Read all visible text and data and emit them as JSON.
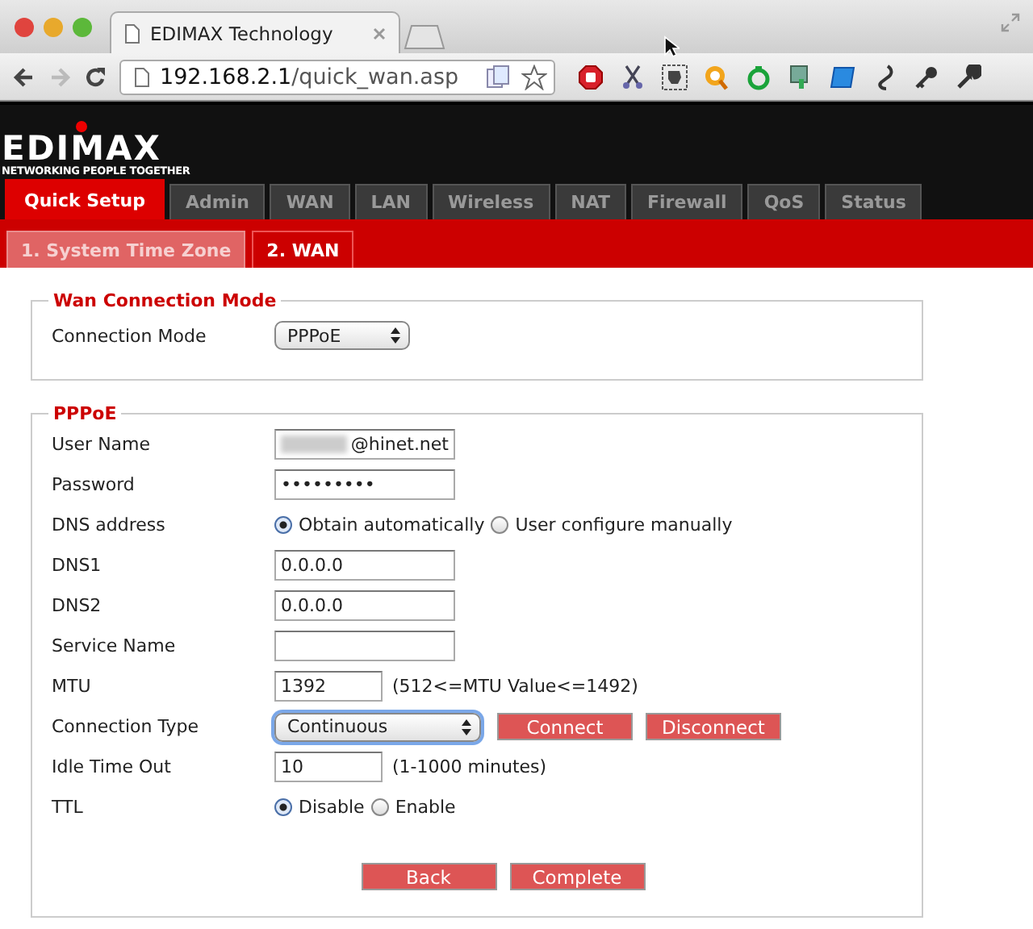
{
  "browser": {
    "tab_title": "EDIMAX Technology",
    "url_host": "192.168.2.1",
    "url_path": "/quick_wan.asp",
    "forward_disabled": true
  },
  "header": {
    "logo": "EDIMAX",
    "tagline": "NETWORKING PEOPLE TOGETHER"
  },
  "tabs": [
    {
      "label": "Quick Setup",
      "selected": true
    },
    {
      "label": "Admin",
      "selected": false
    },
    {
      "label": "WAN",
      "selected": false
    },
    {
      "label": "LAN",
      "selected": false
    },
    {
      "label": "Wireless",
      "selected": false
    },
    {
      "label": "NAT",
      "selected": false
    },
    {
      "label": "Firewall",
      "selected": false
    },
    {
      "label": "QoS",
      "selected": false
    },
    {
      "label": "Status",
      "selected": false
    }
  ],
  "subtabs": [
    {
      "label": "1. System Time Zone",
      "selected": false
    },
    {
      "label": "2. WAN",
      "selected": true
    }
  ],
  "wan_mode": {
    "legend": "Wan Connection Mode",
    "label": "Connection Mode",
    "value": "PPPoE"
  },
  "pppoe": {
    "legend": "PPPoE",
    "rows": [
      {
        "label": "User Name",
        "kind": "text",
        "value": "@hinet.net",
        "redacted": true
      },
      {
        "label": "Password",
        "kind": "text",
        "value": "•••••••••"
      },
      {
        "label": "DNS address",
        "kind": "radio",
        "options": [
          {
            "label": "Obtain automatically",
            "selected": true
          },
          {
            "label": "User configure manually",
            "selected": false
          }
        ]
      },
      {
        "label": "DNS1",
        "kind": "text",
        "value": "0.0.0.0"
      },
      {
        "label": "DNS2",
        "kind": "text",
        "value": "0.0.0.0"
      },
      {
        "label": "Service Name",
        "kind": "text"
      },
      {
        "label": "MTU",
        "kind": "short_text",
        "value": "1392",
        "note": "(512<=MTU Value<=1492)"
      },
      {
        "label": "Connection Type",
        "kind": "select",
        "value": "Continuous",
        "focused": true,
        "buttons": [
          "Connect",
          "Disconnect"
        ]
      },
      {
        "label": "Idle Time Out",
        "kind": "short_text",
        "value": "10",
        "note": "(1-1000 minutes)"
      },
      {
        "label": "TTL",
        "kind": "radio",
        "options": [
          {
            "label": "Disable",
            "selected": true
          },
          {
            "label": "Enable",
            "selected": false
          }
        ]
      }
    ],
    "buttons": [
      "Back",
      "Complete"
    ]
  }
}
